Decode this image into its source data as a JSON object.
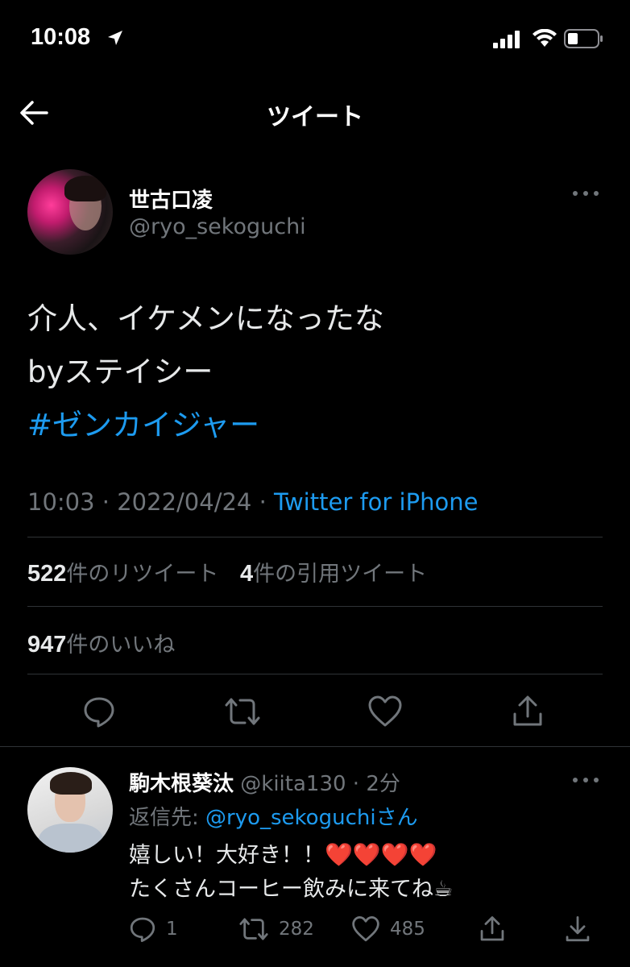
{
  "status_bar": {
    "time": "10:08"
  },
  "nav": {
    "title": "ツイート"
  },
  "tweet": {
    "author_name": "世古口凌",
    "author_handle": "@ryo_sekoguchi",
    "text_line1": "介人、イケメンになったな",
    "text_line2": "byステイシー",
    "hashtag": "#ゼンカイジャー",
    "time": "10:03",
    "date": "2022/04/24",
    "source": "Twitter for iPhone",
    "retweet_count": "522",
    "retweet_label": "件のリツイート",
    "quote_count": "4",
    "quote_label": "件の引用ツイート",
    "like_count": "947",
    "like_label": "件のいいね"
  },
  "reply": {
    "author_name": "駒木根葵汰",
    "author_handle": "@kiita130",
    "time": "2分",
    "reply_to_prefix": "返信先:",
    "reply_to_mention": "@ryo_sekoguchi",
    "reply_to_suffix": "さん",
    "text_line1": "嬉しい！大好き！！",
    "text_line2": "たくさんコーヒー飲みに来てね",
    "hearts": "❤️❤️❤️❤️",
    "coffee": "☕",
    "reply_count": "1",
    "retweet_count": "282",
    "like_count": "485"
  },
  "colors": {
    "background": "#000000",
    "accent": "#1d9bf0",
    "muted": "#71767b",
    "divider": "#2f3336"
  }
}
